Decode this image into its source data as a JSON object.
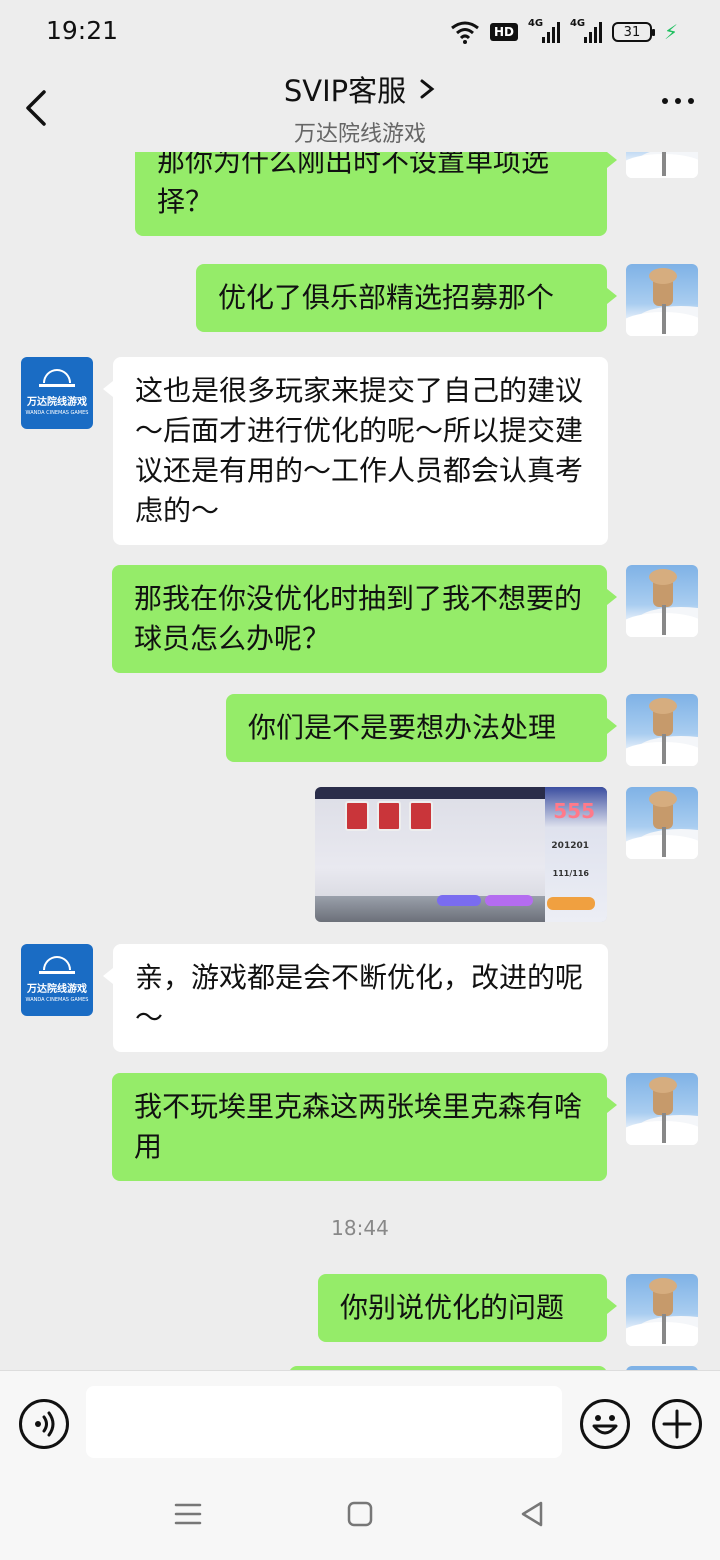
{
  "status_bar": {
    "time": "19:21",
    "network_badge": "HD",
    "network_1": "4G",
    "network_2": "4G",
    "battery_level": "31",
    "icons": [
      "wifi-icon",
      "hd-icon",
      "signal-icon",
      "signal-icon",
      "battery-icon",
      "charging-icon"
    ]
  },
  "header": {
    "title": "SVIP客服",
    "subtitle": "万达院线游戏"
  },
  "brand": {
    "logo_text_cn": "万达院线游戏",
    "logo_text_en": "WANDA CINEMAS GAMES",
    "logo_color": "#1a6cc4"
  },
  "colors": {
    "my_bubble": "#95ec69",
    "other_bubble": "#ffffff",
    "background": "#ededed"
  },
  "messages": [
    {
      "from": "me",
      "text": "那你为什么刚出时不设置单项选择？"
    },
    {
      "from": "me",
      "text": "优化了俱乐部精选招募那个"
    },
    {
      "from": "other",
      "text": "这也是很多玩家来提交了自己的建议～后面才进行优化的呢～所以提交建议还是有用的～工作人员都会认真考虑的～"
    },
    {
      "from": "me",
      "text": "那我在你没优化时抽到了我不想要的球员怎么办呢？"
    },
    {
      "from": "me",
      "text": "你们是不是要想办法处理"
    },
    {
      "from": "me",
      "type": "image",
      "image_text": "555",
      "image_number": "201201",
      "image_sub": "111/116"
    },
    {
      "from": "other",
      "text": "亲，游戏都是会不断优化，改进的呢～"
    },
    {
      "from": "me",
      "text": "我不玩埃里克森这两张埃里克森有啥用"
    },
    {
      "type": "time",
      "text": "18:44"
    },
    {
      "from": "me",
      "text": "你别说优化的问题"
    }
  ],
  "input": {
    "value": "",
    "placeholder": ""
  }
}
